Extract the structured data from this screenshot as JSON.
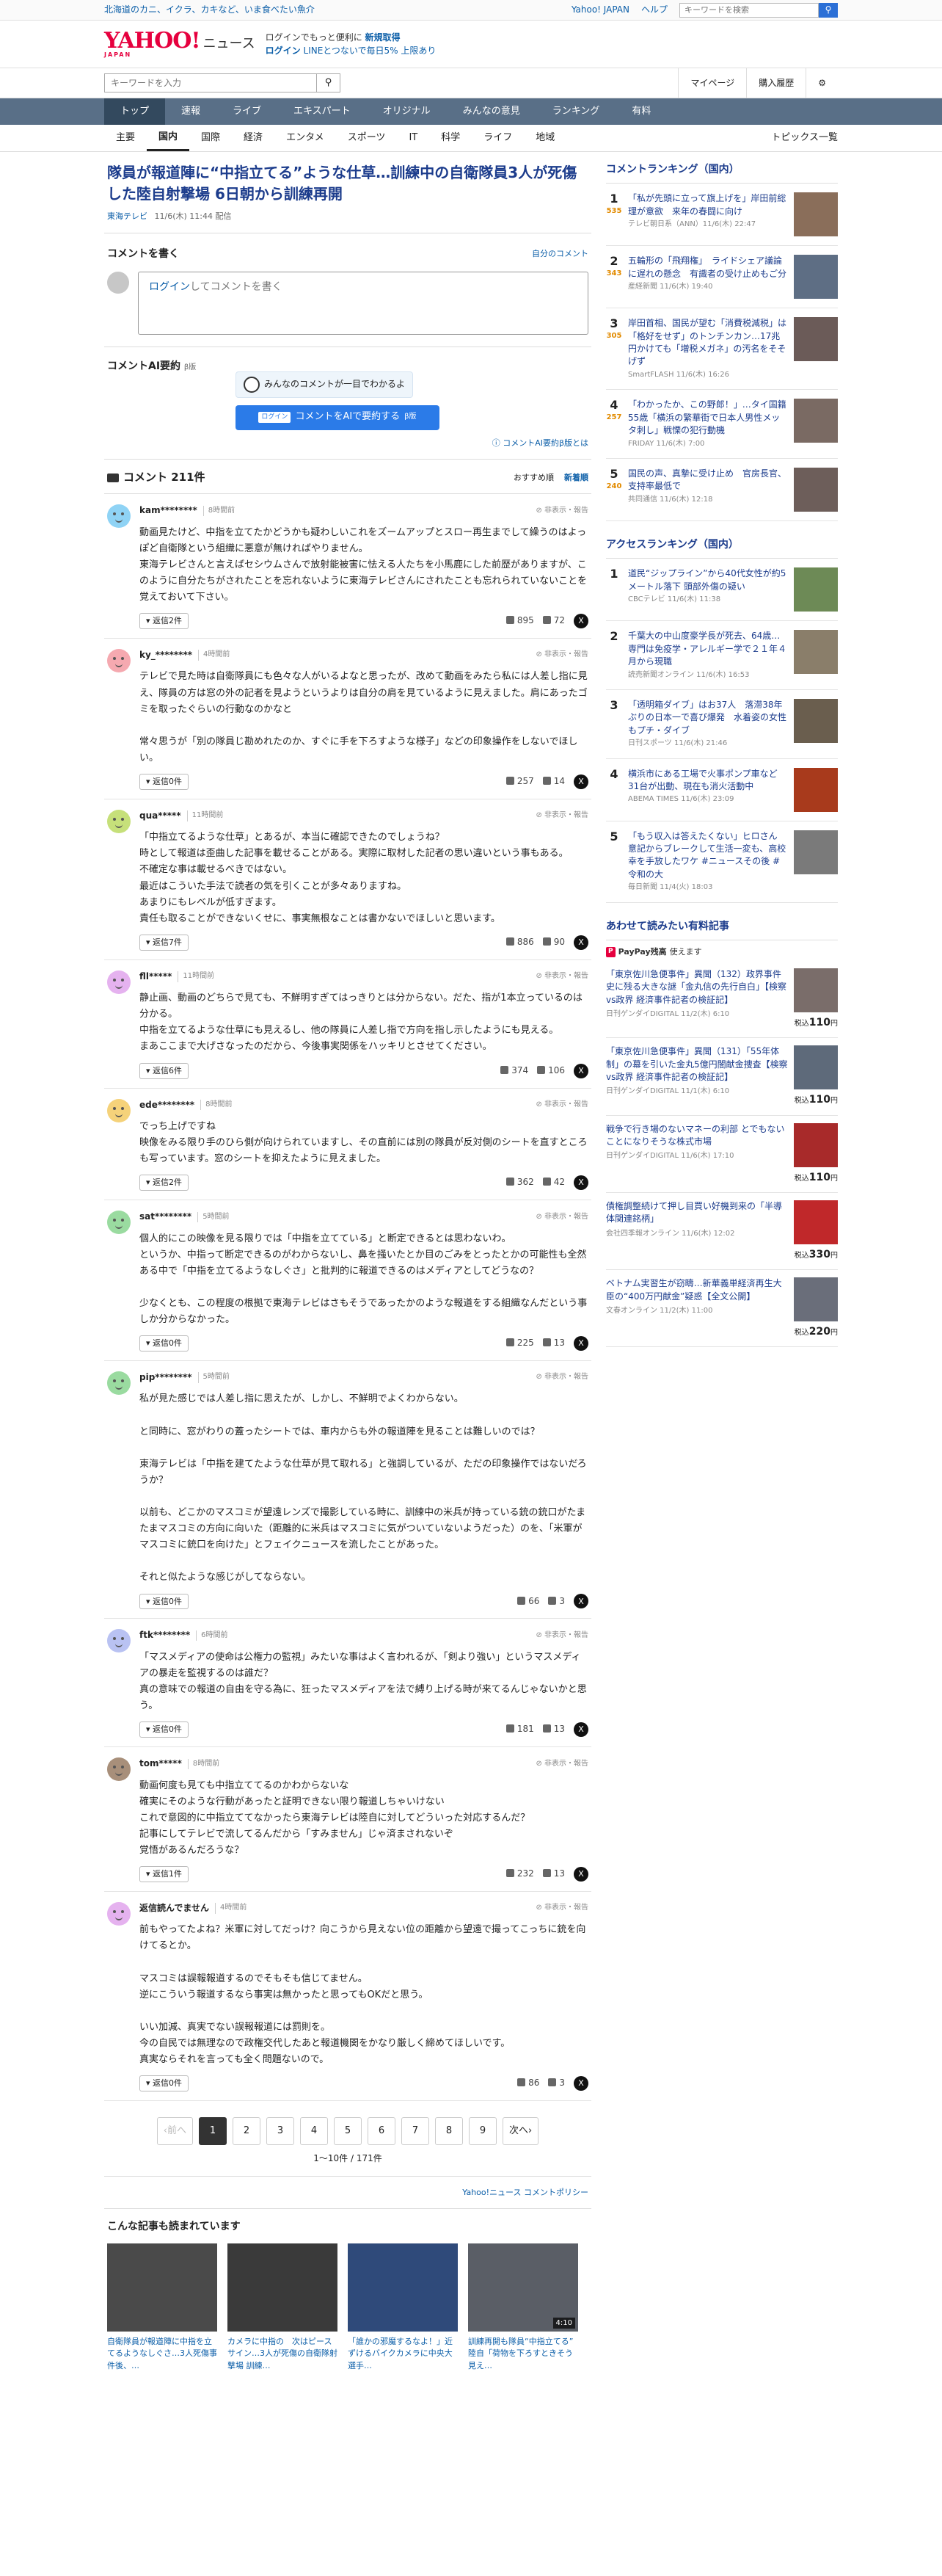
{
  "topbar": {
    "promo": "北海道のカニ、イクラ、カキなど、いま食べたい魚介",
    "yahoo_japan": "Yahoo! JAPAN",
    "help": "ヘルプ",
    "search_placeholder": "キーワードを検索"
  },
  "header": {
    "logo": "YAHOO!",
    "logo_sub": "JAPAN",
    "service": "ニュース",
    "promo_line1_a": "ログインで",
    "promo_line1_b": "もっと便利に",
    "promo_line1_c": "新規取得",
    "promo_line2_a": "ログイン",
    "promo_line2_b": "LINEとつないで毎日5%",
    "promo_line2_c": "上限あり"
  },
  "searchrow": {
    "placeholder": "キーワードを入力",
    "mypage": "マイページ",
    "history": "購入履歴"
  },
  "nav": [
    "トップ",
    "速報",
    "ライブ",
    "エキスパート",
    "オリジナル",
    "みんなの意見",
    "ランキング",
    "有料"
  ],
  "subnav": [
    "主要",
    "国内",
    "国際",
    "経済",
    "エンタメ",
    "スポーツ",
    "IT",
    "科学",
    "ライフ",
    "地域"
  ],
  "subnav_topics": "トピックス一覧",
  "article": {
    "title": "隊員が報道陣に“中指立てる”ような仕草…訓練中の自衛隊員3人が死傷した陸自射撃場 6日朝から訓練再開",
    "source": "東海テレビ",
    "date": "11/6(木) 11:44 配信"
  },
  "write": {
    "heading": "コメントを書く",
    "my_comments": "自分のコメント",
    "login": "ログイン",
    "prompt": "してコメントを書く"
  },
  "ai": {
    "title": "コメントAI要約",
    "beta": "β版",
    "bubble": "みんなのコメントが一目でわかるよ",
    "button_tag": "ログイン",
    "button": "コメントをAIで要約する",
    "button_beta": "β版",
    "note": "コメントAI要約β版とは"
  },
  "comments_header": {
    "title": "コメント 211件",
    "sort_recommended": "おすすめ順",
    "sort_new": "新着順"
  },
  "comments": [
    {
      "user": "kam********",
      "time": "8時間前",
      "report": "非表示・報告",
      "avatar": "#8fd3f5",
      "text": "動画見たけど、中指を立てたかどうかも疑わしいこれをズームアップとスロー再生までして繰うのはよっぽど自衛隊という組織に悪意が無ければやりません。\n東海テレビさんと言えばセシウムさんで放射能被害に怯える人たちを小馬鹿にした前歴がありますが、このように自分たちがされたことを忘れないように東海テレビさんにされたことも忘れられていないことを覚えておいて下さい。",
      "replies": "返信2件",
      "up": "895",
      "down": "72"
    },
    {
      "user": "ky_********",
      "time": "4時間前",
      "report": "非表示・報告",
      "avatar": "#f5a9b0",
      "text": "テレビで見た時は自衛隊員にも色々な人がいるよなと思ったが、改めて動画をみたら私には人差し指に見え、隊員の方は窓の外の記者を見ようというよりは自分の肩を見ているように見えました。肩にあったゴミを取ったぐらいの行動なのかなと\n\n常々思うが「別の隊員じ勘めれたのか、すぐに手を下ろすような様子」などの印象操作をしないでほしい。",
      "replies": "返信0件",
      "up": "257",
      "down": "14"
    },
    {
      "user": "qua*****",
      "time": "11時間前",
      "report": "非表示・報告",
      "avatar": "#c6e07a",
      "text": "「中指立てるような仕草」とあるが、本当に確認できたのでしょうね？\n時として報道は歪曲した記事を載せることがある。実際に取材した記者の思い違いという事もある。\n不確定な事は載せるべきではない。\n最近はこういた手法で読者の気を引くことが多々ありますね。\nあまりにもレベルが低すぎます。\n責任も取ることができないくせに、事実無根なことは書かないでほしいと思います。",
      "replies": "返信7件",
      "up": "886",
      "down": "90"
    },
    {
      "user": "fll*****",
      "time": "11時間前",
      "report": "非表示・報告",
      "avatar": "#e5b2ef",
      "text": "静止画、動画のどちらで見ても、不鮮明すぎてはっきりとは分からない。だた、指が1本立っているのは分かる。\n中指を立てるような仕草にも見えるし、他の隊員に人差し指で方向を指し示したようにも見える。\nまあここまで大げさなったのだから、今後事実関係をハッキリとさせてください。",
      "replies": "返信6件",
      "up": "374",
      "down": "106"
    },
    {
      "user": "ede********",
      "time": "8時間前",
      "report": "非表示・報告",
      "avatar": "#f5d27a",
      "text": "でっち上げですね\n映像をみる限り手のひら側が向けられていますし、その直前には別の隊員が反対側のシートを直すところも写っています。窓のシートを抑えたように見えました。",
      "replies": "返信2件",
      "up": "362",
      "down": "42"
    },
    {
      "user": "sat********",
      "time": "5時間前",
      "report": "非表示・報告",
      "avatar": "#9adba0",
      "text": "個人的にこの映像を見る限りでは「中指を立てている」と断定できるとは思わないわ。\nというか、中指って断定できるのがわからないし、鼻を掻いたとか目のごみをとったとかの可能性も全然ある中で「中指を立てるようなしぐさ」と批判的に報道できるのはメディアとしてどうなの？\n\n少なくとも、この程度の根拠で東海テレビはさもそうであったかのような報道をする組織なんだという事しか分からなかった。",
      "replies": "返信0件",
      "up": "225",
      "down": "13"
    },
    {
      "user": "pip********",
      "time": "5時間前",
      "report": "非表示・報告",
      "avatar": "#9adba0",
      "text": "私が見た感じでは人差し指に思えたが、しかし、不鮮明でよくわからない。\n\nと同時に、窓がわりの蓋ったシートでは、車内からも外の報道陣を見ることは難しいのでは？\n\n東海テレビは「中指を建てたような仕草が見て取れる」と強調しているが、ただの印象操作ではないだろうか？\n\n以前も、どこかのマスコミが望遠レンズで撮影している時に、訓練中の米兵が持っている銃の銃口がたまたまマスコミの方向に向いた（距離的に米兵はマスコミに気がついていないようだった）のを、「米軍がマスコミに銃口を向けた」とフェイクニュースを流したことがあった。\n\nそれと似たような感じがしてならない。",
      "replies": "返信0件",
      "up": "66",
      "down": "3"
    },
    {
      "user": "ftk********",
      "time": "6時間前",
      "report": "非表示・報告",
      "avatar": "#b9c2f2",
      "text": "「マスメディアの使命は公権力の監視」みたいな事はよく言われるが、「剣より強い」というマスメディアの暴走を監視するのは誰だ？\n真の意味での報道の自由を守る為に、狂ったマスメディアを法で縛り上げる時が来てるんじゃないかと思う。",
      "replies": "返信0件",
      "up": "181",
      "down": "13"
    },
    {
      "user": "tom*****",
      "time": "8時間前",
      "report": "非表示・報告",
      "avatar": "#a88f7a",
      "text": "動画何度も見ても中指立ててるのかわからないな\n確実にそのような行動があったと証明できない限り報道しちゃいけない\nこれで意図的に中指立ててなかったら東海テレビは陸自に対してどういった対応するんだ？\n記事にしてテレビで流してるんだから「すみません」じゃ済まされないぞ\n覚悟があるんだろうな？",
      "replies": "返信1件",
      "up": "232",
      "down": "13"
    },
    {
      "user": "返信読んでません",
      "time": "4時間前",
      "report": "非表示・報告",
      "avatar": "#e5b2ef",
      "text": "前もやってたよね？米軍に対してだっけ？向こうから見えない位の距離から望遠で撮ってこっちに銃を向けてるとか。\n\nマスコミは誤報報道するのでそもそも信じてません。\n逆にこういう報道するなら事実は無かったと思ってもOKだと思う。\n\nいい加減、真実でない誤報報道には罰則を。\n今の自民では無理なので政権交代したあと報道機関をかなり厳しく締めてほしいです。\n真実ならそれを言っても全く問題ないので。",
      "replies": "返信0件",
      "up": "86",
      "down": "3"
    }
  ],
  "pager": {
    "prev": "前へ",
    "pages": [
      "1",
      "2",
      "3",
      "4",
      "5",
      "6",
      "7",
      "8",
      "9"
    ],
    "next": "次へ",
    "count": "1〜10件 / 171件"
  },
  "policy": "Yahoo!ニュース コメントポリシー",
  "related": {
    "title": "こんな記事も読まれています",
    "items": [
      {
        "text": "自衛隊員が報道陣に中指を立てるようなしぐさ…3人死傷事件後、…",
        "dur": ""
      },
      {
        "text": "カメラに中指の　次はピースサイン…3人が死傷の自衛隊射撃場 訓練…",
        "dur": ""
      },
      {
        "text": "「誰かの邪魔するなよ！」近ずけるバイクカメラに中央大選手…",
        "dur": ""
      },
      {
        "text": "訓練再開も隊員“中指立てる”　陸自「荷物を下ろすときそう見え…",
        "dur": "4:10"
      }
    ]
  },
  "ranking": {
    "title": "コメントランキング（国内）",
    "items": [
      {
        "num": "1",
        "cnt": "535",
        "text": "「私が先頭に立って旗上げを」岸田前総理が意欲　来年の春闘に向け",
        "meta": "テレビ朝日系（ANN）11/6(木) 22:47",
        "color": "#8a6e5a"
      },
      {
        "num": "2",
        "cnt": "343",
        "text": "五輪形の「飛翔権」　ライドシェア議論に遅れの懸念　有識者の受け止めもご分",
        "meta": "産経新聞 11/6(木) 19:40",
        "color": "#5e6e84"
      },
      {
        "num": "3",
        "cnt": "305",
        "text": "岸田首相、国民が望む「消費税減税」は「格好をせず」のトンチンカン…17兆円かけても「増税メガネ」の汚名をそそげず",
        "meta": "SmartFLASH 11/6(木) 16:26",
        "color": "#6b5b58"
      },
      {
        "num": "4",
        "cnt": "257",
        "text": "「わかったか、この野郎！」…タイ国籍55歳「横浜の繁華街で日本人男性メッタ刺し」戦慄の犯行動機",
        "meta": "FRIDAY 11/6(木) 7:00",
        "color": "#7a6a63"
      },
      {
        "num": "5",
        "cnt": "240",
        "text": "国民の声、真摯に受け止め　官房長官、支持率最低で",
        "meta": "共同通信 11/6(木) 12:18",
        "color": "#6d5e5a"
      }
    ]
  },
  "access": {
    "title": "アクセスランキング（国内）",
    "items": [
      {
        "num": "1",
        "text": "道民“ジップライン”から40代女性が約5メートル落下 頭部外傷の疑い",
        "meta": "CBCテレビ 11/6(木) 11:38",
        "color": "#6d8a56"
      },
      {
        "num": "2",
        "text": "千葉大の中山度豪学長が死去、64歳…専門は免疫学・アレルギー学で２１年４月から現職",
        "meta": "読売新聞オンライン 11/6(木) 16:53",
        "color": "#8a7e6a"
      },
      {
        "num": "3",
        "text": "「透明箱ダイブ」はお37人　落滞38年ぶりの日本一で喜び爆発　水着姿の女性もプチ・ダイブ",
        "meta": "日刊スポーツ 11/6(木) 21:46",
        "color": "#6a5e4e"
      },
      {
        "num": "4",
        "text": "横浜市にある工場で火事ポンプ車など31台が出動、現在も消火活動中",
        "meta": "ABEMA TIMES 11/6(木) 23:09",
        "color": "#a83a1c"
      },
      {
        "num": "5",
        "text": "「もう収入は答えたくない」ヒロさん　意記からブレークして生活一変も、高校幸を手放したワケ #ニュースその後 #令和の大",
        "meta": "毎日新聞 11/4(火) 18:03",
        "color": "#7a7a7a"
      }
    ]
  },
  "ads": {
    "title": "あわせて読みたい有料記事",
    "paypay": "PayPay残高",
    "paypay_tail": "使えます",
    "items": [
      {
        "text": "「東京佐川急便事件」異聞（132）政界事件史に残る大きな謎「金丸信の先行自白」【検察vs政界 経済事件記者の検証記】",
        "meta": "日刊ゲンダイDIGITAL 11/2(木) 6:10",
        "price_pre": "税込",
        "price": "110",
        "price_unit": "円",
        "color": "#7a6d6a"
      },
      {
        "text": "「東京佐川急便事件」異聞（131）「55年体制」の幕を引いた金丸5億円闇献金捜査【検察vs政界 経済事件記者の検証記】",
        "meta": "日刊ゲンダイDIGITAL 11/1(木) 6:10",
        "price_pre": "税込",
        "price": "110",
        "price_unit": "円",
        "color": "#5e6a7a"
      },
      {
        "text": "戦争で行き場のないマネーの利部 とでもないことになりそうな株式市場",
        "meta": "日刊ゲンダイDIGITAL 11/6(木) 17:10",
        "price_pre": "税込",
        "price": "110",
        "price_unit": "円",
        "color": "#a82a2a"
      },
      {
        "text": "債権調整続けて押し目買い好機到来の「半導体関連銘柄」",
        "meta": "会社四季報オンライン 11/6(木) 12:02",
        "price_pre": "税込",
        "price": "330",
        "price_unit": "円",
        "color": "#c0282a"
      },
      {
        "text": "ベトナム実習生が窃疇…新華義単経済再生大臣の“400万円献金”疑惑【全文公開】",
        "meta": "文春オンライン 11/2(木) 11:00",
        "price_pre": "税込",
        "price": "220",
        "price_unit": "円",
        "color": "#6a6e7a"
      }
    ]
  }
}
